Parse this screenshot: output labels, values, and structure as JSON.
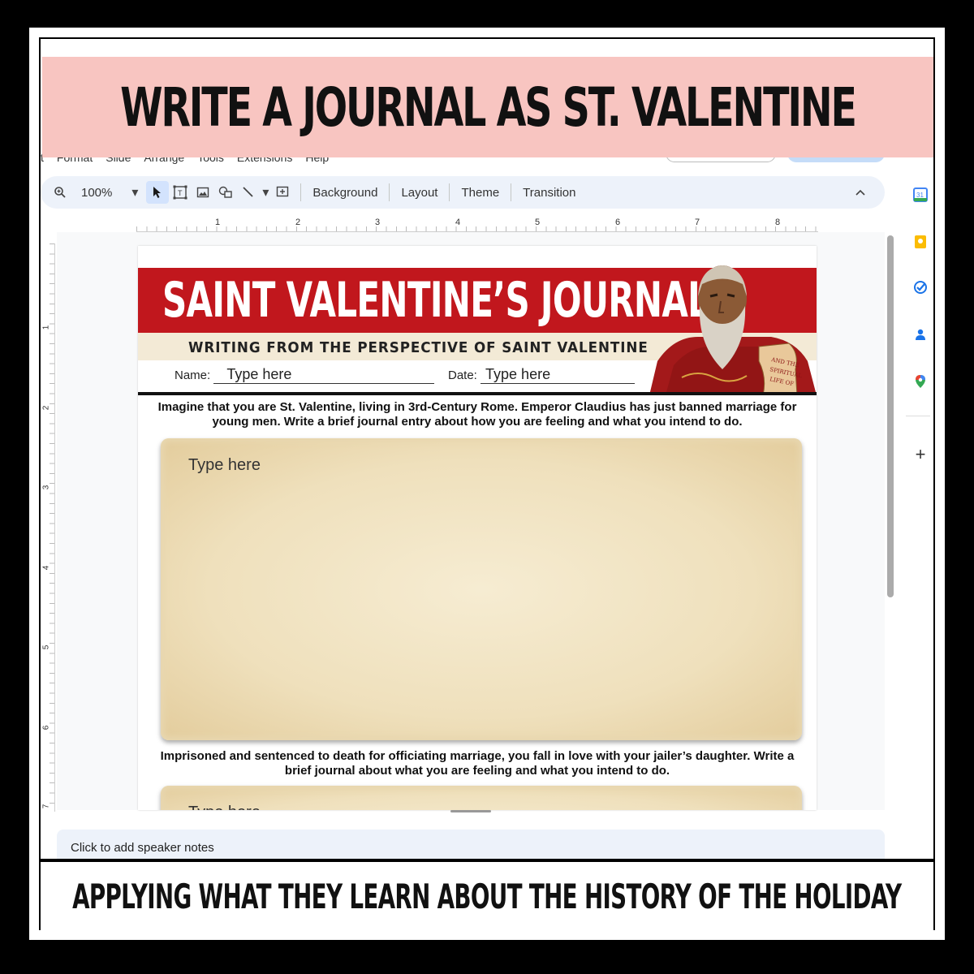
{
  "top_banner": "WRITE A JOURNAL AS ST. VALENTINE",
  "bottom_banner": "APPLYING WHAT THEY LEARN ABOUT THE HISTORY OF THE HOLIDAY",
  "menubar": [
    "t",
    "Format",
    "Slide",
    "Arrange",
    "Tools",
    "Extensions",
    "Help"
  ],
  "toolbar": {
    "zoom": "100%",
    "background": "Background",
    "layout": "Layout",
    "theme": "Theme",
    "transition": "Transition"
  },
  "ruler_h": [
    "1",
    "2",
    "3",
    "4",
    "5",
    "6",
    "7",
    "8"
  ],
  "ruler_v": [
    "1",
    "2",
    "3",
    "4",
    "5",
    "6",
    "7"
  ],
  "slide": {
    "title": "SAINT VALENTINE’S JOURNAL",
    "subtitle": "WRITING FROM THE PERSPECTIVE OF SAINT VALENTINE",
    "name_label": "Name:",
    "name_value": "Type here",
    "date_label": "Date:",
    "date_value": "Type here",
    "scroll_text": [
      "AND THE",
      "SPIRITUAL",
      "LIFE OF"
    ],
    "prompt1": "Imagine that you are St. Valentine, living in 3rd-Century Rome. Emperor Claudius has just banned marriage for young men. Write a brief journal entry about how you are feeling and what you intend to do.",
    "journal1_placeholder": "Type here",
    "prompt2": "Imprisoned and sentenced to death for officiating marriage, you fall in love with your jailer’s daughter. Write a brief journal about what you are feeling and what you intend to do.",
    "journal2_placeholder": "Type here"
  },
  "speaker_notes": "Click to add speaker notes",
  "side_panel": {
    "calendar_day": "31",
    "add": "+"
  },
  "colors": {
    "banner_pink": "#f8c5c1",
    "title_red": "#c1171d",
    "toolbar_bg": "#edf2fa"
  }
}
